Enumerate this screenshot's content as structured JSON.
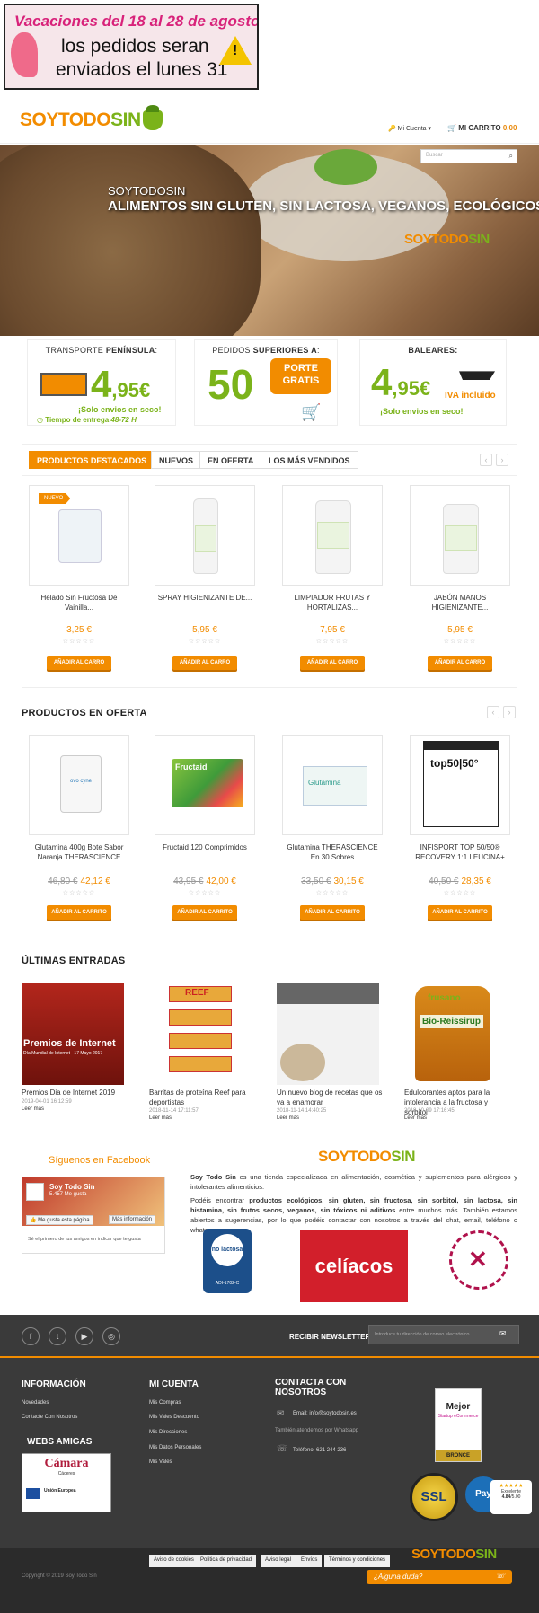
{
  "promo": {
    "line1": "Vacaciones del 18 al 28 de agosto",
    "line2": "los pedidos seran",
    "line3": "enviados el lunes 31"
  },
  "header": {
    "logo": {
      "a": "SOYTODO",
      "b": "SIN"
    },
    "account": "Mi Cuenta",
    "cart_label": "MI CARRITO",
    "cart_amount": "0,00"
  },
  "hero": {
    "search_placeholder": "Buscar",
    "brand": "SOYTODOSIN",
    "headline": "ALIMENTOS SIN GLUTEN, SIN LACTOSA, VEGANOS, ECOLÓGICOS..."
  },
  "info": {
    "b1": {
      "title_a": "TRANSPORTE ",
      "title_b": "PENÍNSULA",
      "title_c": ":",
      "price": "4",
      "cents": ",95€",
      "note": "¡Solo envios en seco!",
      "time_a": "Tiempo de entrega ",
      "time_b": "48-72 H"
    },
    "b2": {
      "title_a": "PEDIDOS ",
      "title_b": "SUPERIORES A",
      "title_c": ":",
      "amount": "50",
      "porte1": "PORTE",
      "porte2": "GRATIS"
    },
    "b3": {
      "title": "BALEARES:",
      "price": "4",
      "cents": ",95€",
      "iva": "IVA incluido",
      "note": "¡Solo envios en seco!"
    }
  },
  "tabs": [
    "PRODUCTOS DESTACADOS",
    "NUEVOS",
    "EN OFERTA",
    "LOS MÁS VENDIDOS"
  ],
  "featured": [
    {
      "badge": "NUEVO",
      "name": "Helado Sin Fructosa De Vainilla...",
      "price": "3,25 €",
      "stars": "☆☆☆☆☆",
      "button": "AÑADIR AL CARRO"
    },
    {
      "name": "SPRAY HIGIENIZANTE DE...",
      "price": "5,95 €",
      "stars": "☆☆☆☆☆",
      "button": "AÑADIR AL CARRO"
    },
    {
      "name": "LIMPIADOR FRUTAS Y HORTALIZAS...",
      "price": "7,95 €",
      "stars": "☆☆☆☆☆",
      "button": "AÑADIR AL CARRO"
    },
    {
      "name": "JABÓN MANOS HIGIENIZANTE...",
      "price": "5,95 €",
      "stars": "☆☆☆☆☆",
      "button": "AÑADIR AL CARRO"
    }
  ],
  "offers_title": "PRODUCTOS EN OFERTA",
  "offers": [
    {
      "name": "Glutamina 400g Bote Sabor Naranja THERASCIENCE",
      "old": "46,80 €",
      "price": "42,12 €",
      "stars": "☆☆☆☆☆",
      "button": "AÑADIR AL CARRITO",
      "brand": "ovo cyne"
    },
    {
      "name": "Fructaid 120 Comprimidos",
      "old": "43,95 €",
      "price": "42,00 €",
      "stars": "☆☆☆☆☆",
      "button": "AÑADIR AL CARRITO",
      "brand": "Fructaid"
    },
    {
      "name": "Glutamina THERASCIENCE En 30 Sobres",
      "old": "33,50 €",
      "price": "30,15 €",
      "stars": "☆☆☆☆☆",
      "button": "AÑADIR AL CARRITO",
      "brand": "Glutamina"
    },
    {
      "name": "INFISPORT TOP 50/50® RECOVERY 1:1 LEUCINA+",
      "old": "40,50 €",
      "price": "28,35 €",
      "stars": "☆☆☆☆☆",
      "button": "AÑADIR AL CARRITO",
      "brand": "top50|50°"
    }
  ],
  "blog_title": "ÚLTIMAS ENTRADAS",
  "posts": [
    {
      "title": "Premios Dia de Internet 2019",
      "date": "2019-04-01 16:12:59",
      "more": "Leer más",
      "pic1": "Premios de Internet",
      "pic2": "Día Mundial de Internet · 17 Mayo 2017"
    },
    {
      "title": "Barritas de proteína Reef para deportistas",
      "date": "2018-11-14 17:11:57",
      "more": "Leer más",
      "pic1": "REEF"
    },
    {
      "title": "Un nuevo blog de recetas que os va a enamorar",
      "date": "2018-11-14 14:40:25",
      "more": "Leer más"
    },
    {
      "title": "Edulcorantes aptos para la intolerancia a la fructosa y sorbitol",
      "date": "2018-10-09 17:16:45",
      "more": "Leer más",
      "pic1": "frusano",
      "pic2": "Bio-Reissirup"
    }
  ],
  "facebook": {
    "title": "Síguenos en Facebook",
    "page": "Soy Todo Sin",
    "likes": "5.457 Me gusta",
    "like_btn": "Me gusta esta página",
    "more_btn": "Más información",
    "friends": "Sé el primero de tus amigos en indicar que te gusta"
  },
  "about": {
    "p1_a": "Soy Todo Sin",
    "p1_b": " es una tienda especializada en alimentación, cosmética y suplementos para alérgicos y intolerantes alimenticios.",
    "p2_a": "Podéis encontrar ",
    "p2_b": "productos ecológicos, sin gluten, sin fructosa, sin sorbitol, sin lactosa, sin histamina, sin frutos secos, veganos, sin tóxicos ni aditivos",
    "p2_c": " entre muchos más. También estamos abiertos a sugerencias, por lo que podéis contactar con nosotros a través del chat, email, teléfono o whatsapp.",
    "badge1": "no lactosa",
    "badge1_code": "ADI-1702-C",
    "badge2": "celíacos"
  },
  "newsletter": {
    "label": "RECIBIR NEWSLETTER",
    "placeholder": "Introduce tu dirección de correo electrónico"
  },
  "footer": {
    "info_title": "INFORMACIÓN",
    "info_links": [
      "Novedades",
      "Contacte Con Nosotros"
    ],
    "webs_title": "WEBS AMIGAS",
    "camara": "Cámara",
    "camara_sub": "Cáceres",
    "ue": "Unión Europea",
    "account_title": "MI CUENTA",
    "account_links": [
      "Mis Compras",
      "Mis Vales Descuento",
      "Mis Direcciones",
      "Mis Datos Personales",
      "Mis Vales"
    ],
    "contact_title_1": "CONTACTA CON",
    "contact_title_2": "NOSOTROS",
    "email": "Email: info@soytodosin.es",
    "whatsapp": "También atendemos por Whatsapp",
    "phone": "Teléfono: 621 244 236",
    "award_1": "Mejor",
    "award_2": "Startup eCommerce",
    "award_3": "BRONCE",
    "ssl": "SSL",
    "rating_label": "Excelente",
    "rating": "4.84",
    "rating_max": "/5.00",
    "pay": "Pay"
  },
  "bottom": {
    "links": [
      "Aviso de cookies",
      "Política de privacidad",
      "Aviso legal",
      "Envíos",
      "Términos y condiciones"
    ],
    "copyright": "Copyright © 2019 Soy Todo Sin",
    "chat": "¿Alguna duda?"
  },
  "colors": {
    "accent": "#f28c00",
    "green": "#7bb31a",
    "footer": "#3a3a3a"
  }
}
